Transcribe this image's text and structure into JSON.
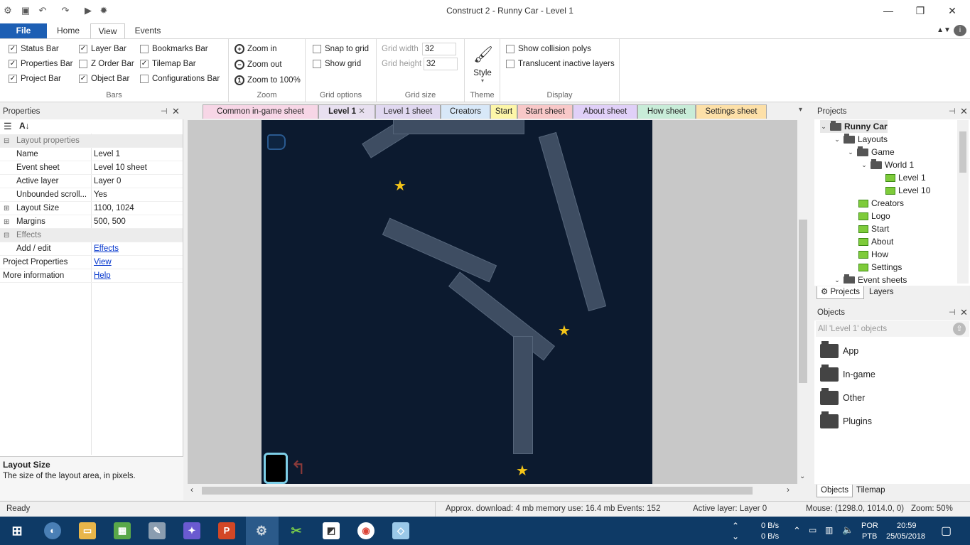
{
  "window": {
    "title": "Construct 2 - Runny Car - Level 1"
  },
  "ribbon_tabs": [
    "File",
    "Home",
    "View",
    "Events"
  ],
  "ribbon": {
    "bars": {
      "name": "Bars",
      "items": [
        {
          "label": "Status Bar",
          "checked": true
        },
        {
          "label": "Properties Bar",
          "checked": true
        },
        {
          "label": "Project Bar",
          "checked": true
        },
        {
          "label": "Layer Bar",
          "checked": true
        },
        {
          "label": "Z Order Bar",
          "checked": false
        },
        {
          "label": "Object Bar",
          "checked": true
        },
        {
          "label": "Bookmarks Bar",
          "checked": false
        },
        {
          "label": "Tilemap Bar",
          "checked": true
        },
        {
          "label": "Configurations Bar",
          "checked": false
        }
      ]
    },
    "zoom": {
      "name": "Zoom",
      "zoom_in": "Zoom in",
      "zoom_out": "Zoom out",
      "zoom_100": "Zoom to 100%"
    },
    "grid_options": {
      "name": "Grid options",
      "snap": "Snap to grid",
      "show": "Show grid"
    },
    "grid_size": {
      "name": "Grid size",
      "width_label": "Grid width",
      "width_value": "32",
      "height_label": "Grid height",
      "height_value": "32"
    },
    "theme": {
      "name": "Theme",
      "style_label": "Style"
    },
    "display": {
      "name": "Display",
      "collision": "Show collision polys",
      "translucent": "Translucent inactive layers"
    }
  },
  "properties": {
    "title": "Properties",
    "rows": [
      {
        "key": "Layout properties",
        "value": "",
        "cat": true,
        "exp": "⊟"
      },
      {
        "key": "Name",
        "value": "Level 1"
      },
      {
        "key": "Event sheet",
        "value": "Level 10 sheet"
      },
      {
        "key": "Active layer",
        "value": "Layer 0"
      },
      {
        "key": "Unbounded scroll...",
        "value": "Yes"
      },
      {
        "key": "Layout Size",
        "value": "1100, 1024",
        "exp": "⊞"
      },
      {
        "key": "Margins",
        "value": "500, 500",
        "exp": "⊞"
      },
      {
        "key": "Effects",
        "value": "",
        "cat": true,
        "exp": "⊟"
      },
      {
        "key": "Add / edit",
        "value": "Effects",
        "link": true
      },
      {
        "key": "Project Properties",
        "value": "View",
        "link": true,
        "top": true
      },
      {
        "key": "More information",
        "value": "Help",
        "link": true,
        "top": true
      }
    ],
    "desc_title": "Layout Size",
    "desc_text": "The size of the layout area, in pixels."
  },
  "doc_tabs": [
    {
      "label": "Common in-game sheet",
      "color": "#f7d6e6"
    },
    {
      "label": "Level 1",
      "color": "#e8e0f0",
      "active": true
    },
    {
      "label": "Level 1 sheet",
      "color": "#e0d8f0"
    },
    {
      "label": "Creators",
      "color": "#d8e8f8"
    },
    {
      "label": "Start",
      "color": "#fdf6a8"
    },
    {
      "label": "Start sheet",
      "color": "#f8c8c8"
    },
    {
      "label": "About sheet",
      "color": "#e0d0f8"
    },
    {
      "label": "How sheet",
      "color": "#c8ecd8"
    },
    {
      "label": "Settings sheet",
      "color": "#fde0a8"
    }
  ],
  "projects": {
    "title": "Projects",
    "tree": [
      {
        "label": "Runny Car",
        "depth": 0,
        "type": "folder",
        "arrow": "⌄",
        "bold": true
      },
      {
        "label": "Layouts",
        "depth": 1,
        "type": "folder",
        "arrow": "⌄"
      },
      {
        "label": "Game",
        "depth": 2,
        "type": "folder",
        "arrow": "⌄"
      },
      {
        "label": "World 1",
        "depth": 3,
        "type": "folder",
        "arrow": "⌄"
      },
      {
        "label": "Level 1",
        "depth": 4,
        "type": "layout"
      },
      {
        "label": "Level 10",
        "depth": 4,
        "type": "layout"
      },
      {
        "label": "Creators",
        "depth": 2,
        "type": "layout"
      },
      {
        "label": "Logo",
        "depth": 2,
        "type": "layout"
      },
      {
        "label": "Start",
        "depth": 2,
        "type": "layout"
      },
      {
        "label": "About",
        "depth": 2,
        "type": "layout"
      },
      {
        "label": "How",
        "depth": 2,
        "type": "layout"
      },
      {
        "label": "Settings",
        "depth": 2,
        "type": "layout"
      },
      {
        "label": "Event sheets",
        "depth": 1,
        "type": "folder",
        "arrow": "⌄"
      }
    ],
    "tabs": [
      "Projects",
      "Layers"
    ]
  },
  "objects": {
    "title": "Objects",
    "filter": "All 'Level 1' objects",
    "folders": [
      "App",
      "In-game",
      "Other",
      "Plugins"
    ],
    "tabs": [
      "Objects",
      "Tilemap"
    ]
  },
  "status": {
    "ready": "Ready",
    "download": "Approx. download: 4 mb  memory use: 16.4 mb  Events: 152",
    "layer": "Active layer: Layer 0",
    "mouse": "Mouse: (1298.0, 1014.0, 0)",
    "zoom": "Zoom: 50%"
  },
  "taskbar": {
    "net_up": "0 B/s",
    "net_down": "0 B/s",
    "lang1": "POR",
    "lang2": "PTB",
    "time": "20:59",
    "date": "25/05/2018"
  },
  "colors": {
    "accent": "#1d5fb4",
    "layout_bg": "#0c1a2f",
    "plank": "#3e4d62",
    "star": "#f5c518",
    "taskbar": "#0e3a66"
  }
}
